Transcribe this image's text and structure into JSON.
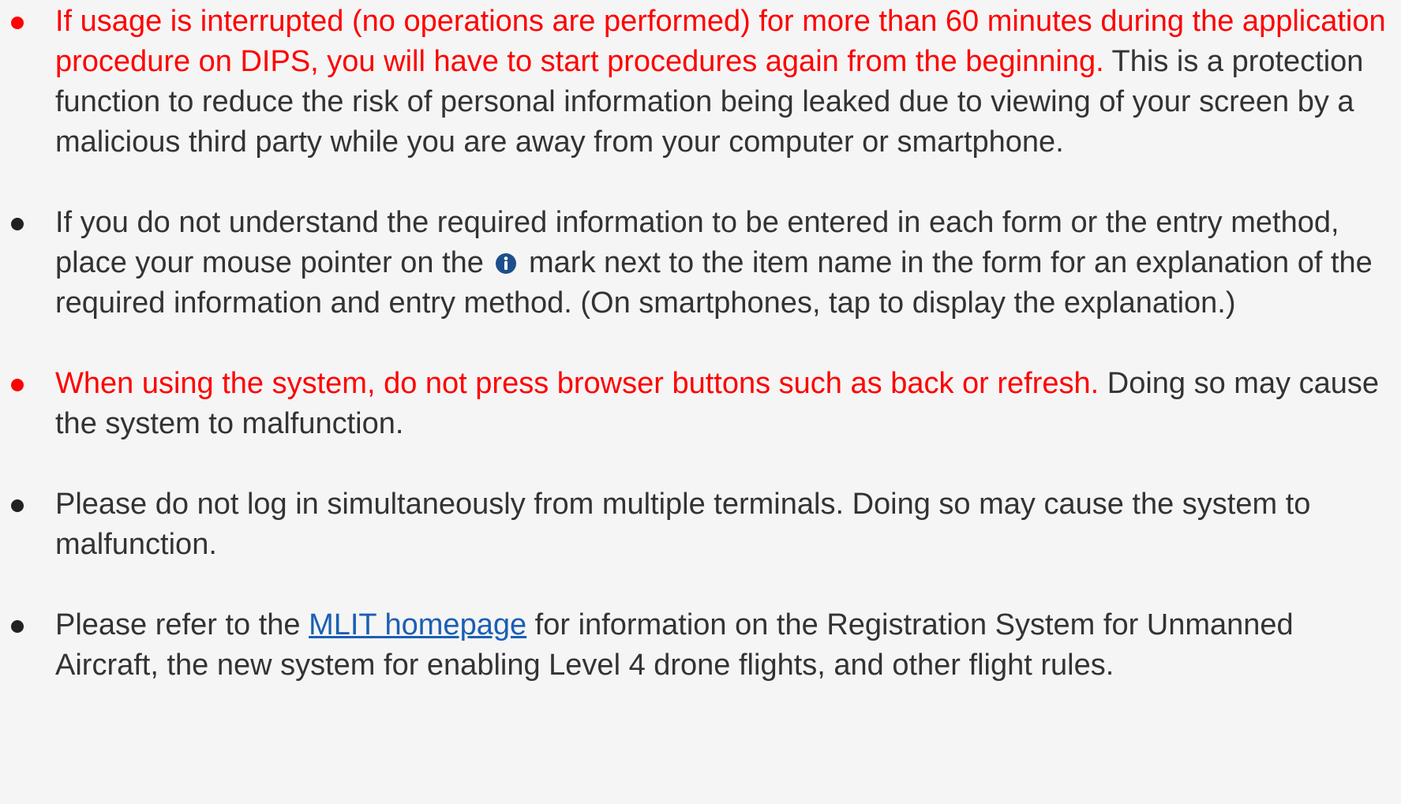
{
  "notices": {
    "timeout": {
      "warning": "If usage is interrupted (no operations are performed) for more than 60 minutes during the application procedure on DIPS, you will have to start procedures again from the beginning.",
      "detail": " This is a protection function to reduce the risk of personal information being leaked due to viewing of your screen by a malicious third party while you are away from your computer or smartphone."
    },
    "info_mark": {
      "before": "If you do not understand the required information to be entered in each form or the entry method, place your mouse pointer on the ",
      "after": " mark next to the item name in the form for an explanation of the required information and entry method. (On smartphones, tap to display the explanation.)",
      "icon": "info-icon"
    },
    "browser_buttons": {
      "warning": "When using the system, do not press browser buttons such as back or refresh.",
      "detail": " Doing so may cause the system to malfunction."
    },
    "multiple_login": {
      "text": "Please do not log in simultaneously from multiple terminals. Doing so may cause the system to malfunction."
    },
    "mlit": {
      "before": "Please refer to the ",
      "link_label": "MLIT homepage",
      "after": " for information on the Registration System for Unmanned Aircraft, the new system for enabling Level 4 drone flights, and other flight rules."
    }
  },
  "colors": {
    "warning_red": "#ff0000",
    "body_text": "#333333",
    "link_blue": "#1a5fb4",
    "info_icon": "#1e4f8c",
    "background": "#f5f5f5"
  }
}
